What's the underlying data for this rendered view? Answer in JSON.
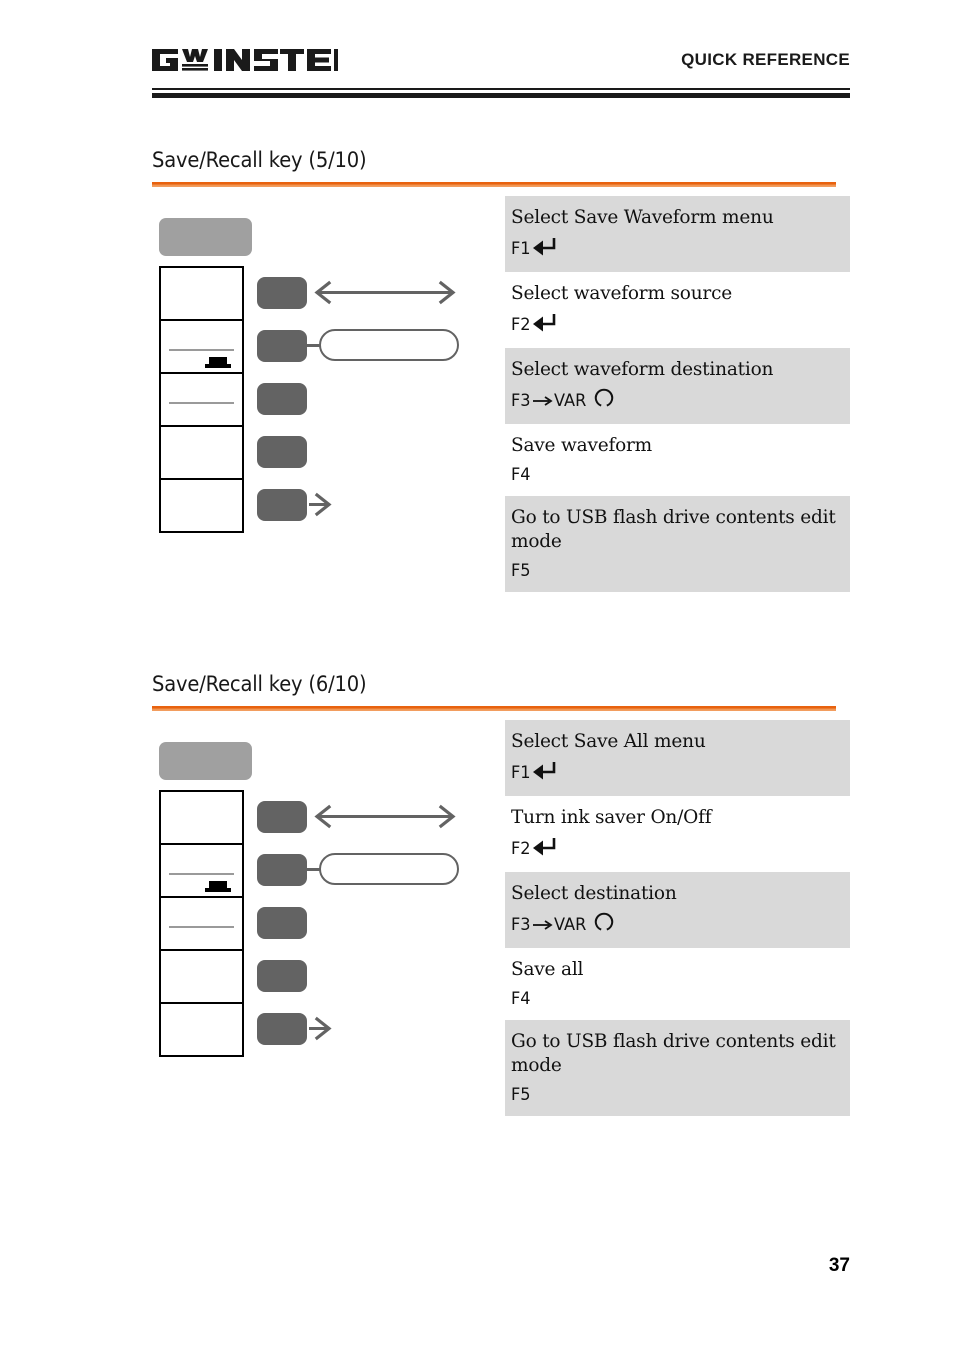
{
  "header": {
    "logo_text": "GW INSTEK",
    "title": "QUICK REFERENCE"
  },
  "sections": [
    {
      "title": "Save/Recall key (5/10)",
      "accent_color": "#e8620f",
      "rows": [
        {
          "desc": "Select Save Waveform menu",
          "key": "F1",
          "glyph": "return-arrow-icon",
          "shaded": true
        },
        {
          "desc": "Select waveform source",
          "key": "F2",
          "glyph": "return-arrow-icon",
          "shaded": false
        },
        {
          "desc": "Select waveform destination",
          "key": "F3",
          "glyph": "var-knob-icon",
          "var_label": "VAR",
          "shaded": true
        },
        {
          "desc": "Save waveform",
          "key": "F4",
          "glyph": "none",
          "shaded": false
        },
        {
          "desc": "Go to USB flash drive contents edit mode",
          "key": "F5",
          "glyph": "none",
          "shaded": true
        }
      ],
      "diagram": {
        "panel_button_color": "#a0a0a0",
        "soft_key_color": "#636363",
        "soft_keys": [
          {
            "annotation": "double-arrow"
          },
          {
            "annotation": "callout-box"
          },
          {
            "annotation": "none"
          },
          {
            "annotation": "none"
          },
          {
            "annotation": "single-arrow"
          }
        ],
        "menu_cells": [
          {
            "line": false,
            "marker": false
          },
          {
            "line": true,
            "marker": true
          },
          {
            "line": true,
            "marker": false
          },
          {
            "line": false,
            "marker": false
          },
          {
            "line": false,
            "marker": false
          }
        ]
      }
    },
    {
      "title": "Save/Recall key (6/10)",
      "accent_color": "#e8620f",
      "rows": [
        {
          "desc": "Select Save All menu",
          "key": "F1",
          "glyph": "return-arrow-icon",
          "shaded": true
        },
        {
          "desc": "Turn ink saver On/Off",
          "key": "F2",
          "glyph": "return-arrow-icon",
          "shaded": false
        },
        {
          "desc": "Select destination",
          "key": "F3",
          "glyph": "var-knob-icon",
          "var_label": "VAR",
          "shaded": true
        },
        {
          "desc": "Save all",
          "key": "F4",
          "glyph": "none",
          "shaded": false
        },
        {
          "desc": "Go to USB flash drive contents edit mode",
          "key": "F5",
          "glyph": "none",
          "shaded": true
        }
      ],
      "diagram": {
        "panel_button_color": "#a0a0a0",
        "soft_key_color": "#636363",
        "soft_keys": [
          {
            "annotation": "double-arrow"
          },
          {
            "annotation": "callout-box"
          },
          {
            "annotation": "none"
          },
          {
            "annotation": "none"
          },
          {
            "annotation": "single-arrow"
          }
        ],
        "menu_cells": [
          {
            "line": false,
            "marker": false
          },
          {
            "line": true,
            "marker": true
          },
          {
            "line": true,
            "marker": false
          },
          {
            "line": false,
            "marker": false
          },
          {
            "line": false,
            "marker": false
          }
        ]
      }
    }
  ],
  "footer": {
    "page_number": "37"
  }
}
